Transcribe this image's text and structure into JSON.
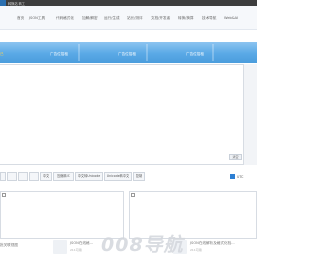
{
  "topbar": {
    "site_text": "转换站 转工"
  },
  "nav": {
    "items": [
      "首页",
      "JSON工具",
      "代码格式化",
      "加解/解密",
      "运行/生成",
      "站长/测评",
      "文档/开发者",
      "转换/换算",
      "技术导航",
      "Web&AI"
    ]
  },
  "ads": {
    "left_fragment": "已",
    "labels": [
      "广告位招租",
      "广告位招租",
      "广告位招租"
    ]
  },
  "editor": {
    "mini_button": "清空"
  },
  "toolbar": {
    "buttons": [
      "",
      "",
      "",
      "",
      "中文",
      "压缩转义",
      "中文转Unicode",
      "Unicode转中文",
      "复制"
    ],
    "checkbox_label": "UTC"
  },
  "bottom": {
    "left_text": "批关联视图",
    "middle_title": "JSON在线格...",
    "middle_sub": "211可用",
    "right_title": "JSON在线解析及格式化验...",
    "right_sub": "211可用",
    "watermark": "008导航"
  },
  "colors": {
    "topbar": "#3d3d3d",
    "adbar": "#5aa9e6",
    "checkbox": "#2d7fd3"
  }
}
